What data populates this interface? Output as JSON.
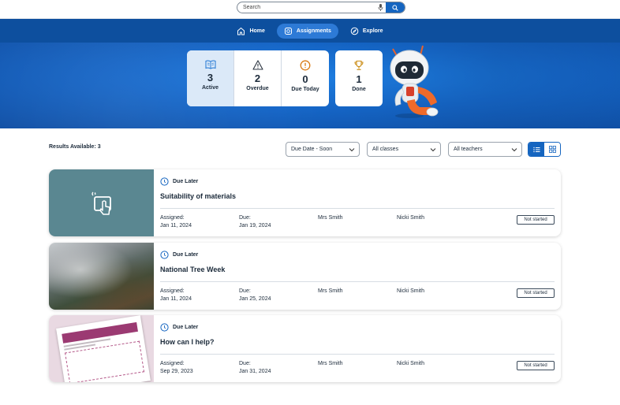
{
  "search": {
    "placeholder": "Search",
    "value": ""
  },
  "nav": {
    "items": [
      {
        "label": "Home",
        "icon": "home-icon",
        "active": false
      },
      {
        "label": "Assignments",
        "icon": "assignments-icon",
        "active": true
      },
      {
        "label": "Explore",
        "icon": "compass-icon",
        "active": false
      }
    ]
  },
  "stats": [
    {
      "value": "3",
      "label": "Active",
      "icon": "open-book-icon",
      "color": "#2f7fd6",
      "selected": true
    },
    {
      "value": "2",
      "label": "Overdue",
      "icon": "warning-triangle-icon",
      "color": "#2b3440",
      "selected": false
    },
    {
      "value": "0",
      "label": "Due Today",
      "icon": "alert-circle-icon",
      "color": "#d97a14",
      "selected": false
    },
    {
      "value": "1",
      "label": "Done",
      "icon": "trophy-icon",
      "color": "#c98a10",
      "selected": false
    }
  ],
  "results": {
    "label": "Results Available: 3"
  },
  "filters": {
    "sort": "Due Date - Soon",
    "classes": "All classes",
    "teachers": "All teachers"
  },
  "view": {
    "active": "list"
  },
  "assignments": [
    {
      "status_due": "Due Later",
      "title": "Suitability of materials",
      "assigned_label": "Assigned:",
      "assigned_date": "Jan 11, 2024",
      "due_label": "Due:",
      "due_date": "Jan 19, 2024",
      "teacher": "Mrs Smith",
      "student": "Nicki Smith",
      "progress": "Not started"
    },
    {
      "status_due": "Due Later",
      "title": "National Tree Week",
      "assigned_label": "Assigned:",
      "assigned_date": "Jan 11, 2024",
      "due_label": "Due:",
      "due_date": "Jan 25, 2024",
      "teacher": "Mrs Smith",
      "student": "Nicki Smith",
      "progress": "Not started"
    },
    {
      "status_due": "Due Later",
      "title": "How can I help?",
      "assigned_label": "Assigned:",
      "assigned_date": "Sep 29, 2023",
      "due_label": "Due:",
      "due_date": "Jan 31, 2024",
      "teacher": "Mrs Smith",
      "student": "Nicki Smith",
      "progress": "Not started"
    }
  ],
  "colors": {
    "brand": "#1565c0",
    "nav": "#0d4f9e",
    "accent_active": "#2d7ad6"
  }
}
